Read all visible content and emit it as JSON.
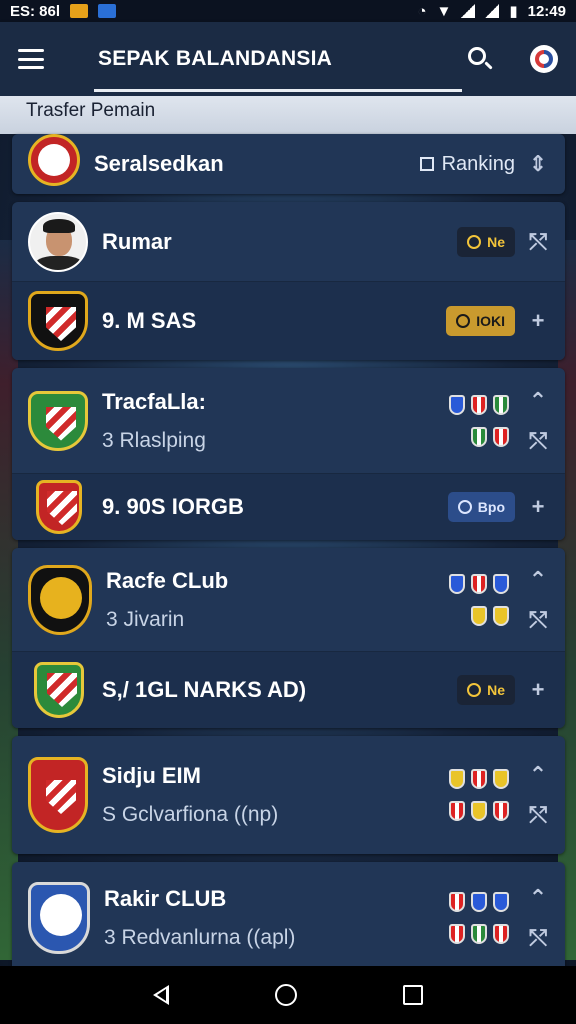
{
  "status_bar": {
    "left_text": "ES: 86l",
    "time": "12:49"
  },
  "app_bar": {
    "title": "SEPAK BALANDANSIA"
  },
  "section": {
    "label": "Trasfer Pemain"
  },
  "header_row": {
    "name": "Seralsedkan",
    "ranking_label": "Ranking",
    "sort_glyph": "⇕"
  },
  "cards": [
    {
      "rows": [
        {
          "kind": "player",
          "name": "Rumar",
          "tag": "Ne",
          "tag_style": "dark",
          "glyph": "⤲"
        },
        {
          "kind": "club",
          "name": "9. M SAS",
          "tag": "IOKI",
          "tag_style": "gold",
          "glyph": "+"
        }
      ]
    },
    {
      "rows": [
        {
          "kind": "club",
          "name": "TracfaLla:",
          "sub": "3  Rlaslping",
          "glyph_top": "⌃",
          "glyph_bottom": "⤲"
        },
        {
          "kind": "club",
          "name": "9. 90S IORGB",
          "tag": "Bpo",
          "tag_style": "blue",
          "glyph": "+"
        }
      ]
    },
    {
      "rows": [
        {
          "kind": "club",
          "name": "Racfe CLub",
          "sub": "3  Jivarin",
          "glyph_top": "⌃",
          "glyph_bottom": "⤲"
        },
        {
          "kind": "club",
          "name": "S,/ 1GL NARKS AD)",
          "tag": "Ne",
          "tag_style": "dark",
          "glyph": "+"
        }
      ]
    },
    {
      "rows": [
        {
          "kind": "club",
          "name": "Sidju EIM",
          "sub": "S  Gclvarfiona ((np)",
          "glyph_top": "⌃",
          "glyph_bottom": "⤲"
        }
      ]
    },
    {
      "rows": [
        {
          "kind": "club",
          "name": "Rakir CLUB",
          "sub": "3  Redvanlurna ((apl)",
          "glyph_top": "⌃",
          "glyph_bottom": "⤲"
        }
      ]
    }
  ]
}
